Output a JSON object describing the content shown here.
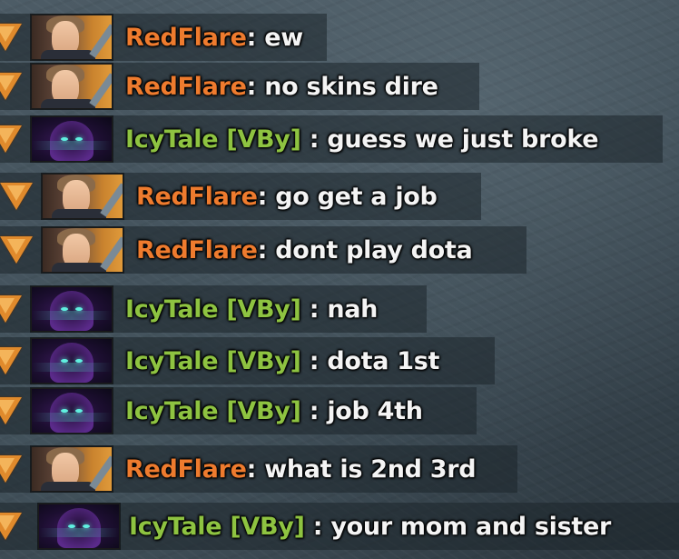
{
  "chat": {
    "messages": [
      {
        "player": "RedFlare",
        "hero": "redflare",
        "team": "red",
        "separator": ": ",
        "text": "ew"
      },
      {
        "player": "RedFlare",
        "hero": "redflare",
        "team": "red",
        "separator": ": ",
        "text": "no skins dire"
      },
      {
        "player": "IcyTale [VBy]",
        "hero": "icytale",
        "team": "green",
        "separator": " : ",
        "text": "guess we just broke"
      },
      {
        "player": "RedFlare",
        "hero": "redflare",
        "team": "red",
        "separator": ": ",
        "text": "go get a job"
      },
      {
        "player": "RedFlare",
        "hero": "redflare",
        "team": "red",
        "separator": ": ",
        "text": "dont play dota"
      },
      {
        "player": "IcyTale [VBy]",
        "hero": "icytale",
        "team": "green",
        "separator": " : ",
        "text": "nah"
      },
      {
        "player": "IcyTale [VBy]",
        "hero": "icytale",
        "team": "green",
        "separator": " : ",
        "text": "dota 1st"
      },
      {
        "player": "IcyTale [VBy]",
        "hero": "icytale",
        "team": "green",
        "separator": " : ",
        "text": "job 4th"
      },
      {
        "player": "RedFlare",
        "hero": "redflare",
        "team": "red",
        "separator": ": ",
        "text": "what is 2nd 3rd"
      },
      {
        "player": "IcyTale [VBy]",
        "hero": "icytale",
        "team": "green",
        "separator": " : ",
        "text": "your mom and sister"
      }
    ]
  },
  "colors": {
    "red_name": "#ee7b2e",
    "green_name": "#8ec341",
    "message_text": "#f4f4f4",
    "team_marker": "#e08a2c"
  },
  "icons": {
    "team_marker": "team-triangle-icon",
    "redflare_portrait": "hero-portrait-redflare",
    "icytale_portrait": "hero-portrait-icytale"
  }
}
